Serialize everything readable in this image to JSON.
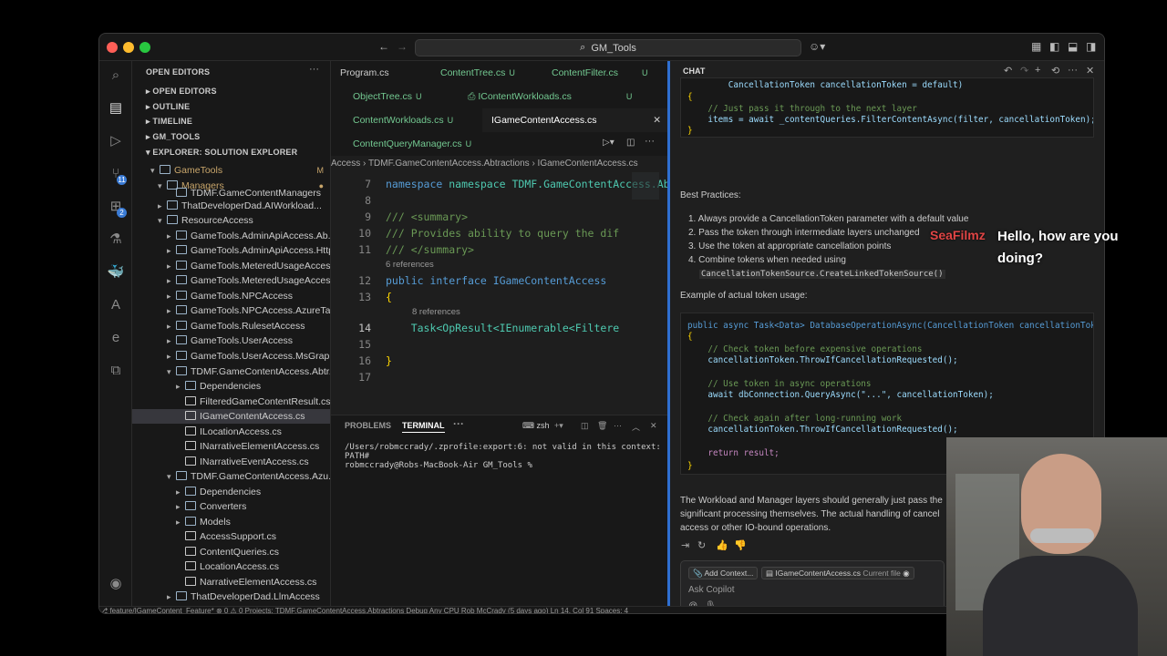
{
  "titlebar": {
    "search_label": "GM_Tools"
  },
  "activity_bar": {
    "icons": [
      "files-icon",
      "search-icon",
      "source-control-icon",
      "run-debug-icon",
      "extensions-icon",
      "testing-icon",
      "docker-icon",
      "azure-icon",
      "edge-icon",
      "remote-explorer-icon",
      "account-icon",
      "settings-gear-icon"
    ],
    "badges": {
      "source_control": "11",
      "extensions": "2"
    }
  },
  "sidebar": {
    "open_editors": "OPEN EDITORS",
    "sections": [
      "OPEN EDITORS",
      "OUTLINE",
      "TIMELINE",
      "GM_TOOLS",
      "EXPLORER: SOLUTION EXPLORER"
    ],
    "tree": [
      {
        "label": "GameTools",
        "mod": "M"
      },
      {
        "label": "Managers",
        "mod": "●"
      },
      {
        "label": "TDMF.GameContentManagers",
        "mod": ""
      },
      {
        "label": "ThatDeveloperDad.AIWorkload...",
        "mod": ""
      },
      {
        "label": "ResourceAccess",
        "mod": ""
      },
      {
        "label": "GameTools.AdminApiAccess.Ab...",
        "mod": ""
      },
      {
        "label": "GameTools.AdminApiAccess.Http",
        "mod": ""
      },
      {
        "label": "GameTools.MeteredUsageAccess",
        "mod": ""
      },
      {
        "label": "GameTools.MeteredUsageAcces...",
        "mod": ""
      },
      {
        "label": "GameTools.NPCAccess",
        "mod": ""
      },
      {
        "label": "GameTools.NPCAccess.AzureTa...",
        "mod": ""
      },
      {
        "label": "GameTools.RulesetAccess",
        "mod": ""
      },
      {
        "label": "GameTools.UserAccess",
        "mod": ""
      },
      {
        "label": "GameTools.UserAccess.MsGrap...",
        "mod": ""
      },
      {
        "label": "TDMF.GameContentAccess.Abtr...",
        "mod": ""
      },
      {
        "label": "Dependencies",
        "mod": ""
      },
      {
        "label": "FilteredGameContentResult.cs",
        "mod": ""
      },
      {
        "label": "IGameContentAccess.cs",
        "mod": ""
      },
      {
        "label": "ILocationAccess.cs",
        "mod": ""
      },
      {
        "label": "INarrativeElementAccess.cs",
        "mod": ""
      },
      {
        "label": "INarrativeEventAccess.cs",
        "mod": ""
      },
      {
        "label": "TDMF.GameContentAccess.Azu...",
        "mod": ""
      },
      {
        "label": "Dependencies",
        "mod": ""
      },
      {
        "label": "Converters",
        "mod": ""
      },
      {
        "label": "Models",
        "mod": ""
      },
      {
        "label": "AccessSupport.cs",
        "mod": ""
      },
      {
        "label": "ContentQueries.cs",
        "mod": ""
      },
      {
        "label": "LocationAccess.cs",
        "mod": ""
      },
      {
        "label": "NarrativeElementAccess.cs",
        "mod": ""
      },
      {
        "label": "ThatDeveloperDad.LlmAccess",
        "mod": ""
      }
    ]
  },
  "tabs": [
    {
      "label": "Program.cs",
      "status": ""
    },
    {
      "label": "ContentTree.cs",
      "status": "U"
    },
    {
      "label": "ContentFilter.cs",
      "status": "U"
    },
    {
      "label": "ObjectTree.cs",
      "status": "U"
    },
    {
      "label": "IContentWorkloads.cs",
      "status": "U"
    },
    {
      "label": "ContentWorkloads.cs",
      "status": "U"
    },
    {
      "label": "IGameContentAccess.cs",
      "status": ""
    },
    {
      "label": "ContentQueryManager.cs",
      "status": "U"
    }
  ],
  "breadcrumb": "Access › TDMF.GameContentAccess.Abtractions › IGameContentAccess.cs",
  "editor": {
    "lines": [
      {
        "n": "7",
        "text": "namespace TDMF.GameContentAccess.Abtr"
      },
      {
        "n": "8",
        "text": ""
      },
      {
        "n": "9",
        "text": "/// <summary>"
      },
      {
        "n": "10",
        "text": "/// Provides ability to query the dif"
      },
      {
        "n": "11",
        "text": "/// </summary>"
      },
      {
        "n": "12",
        "text": "public interface IGameContentAccess"
      },
      {
        "n": "13",
        "text": "{"
      },
      {
        "n": "14",
        "text": "    Task<OpResult<IEnumerable<Filtere"
      },
      {
        "n": "15",
        "text": ""
      },
      {
        "n": "16",
        "text": "}"
      },
      {
        "n": "17",
        "text": ""
      }
    ],
    "refs_interface": "6 references",
    "refs_method": "8 references"
  },
  "panel": {
    "tabs": [
      "PROBLEMS",
      "TERMINAL"
    ],
    "shell": "zsh",
    "terminal_lines": [
      "/Users/robmccrady/.zprofile:export:6: not valid in this context:",
      "PATH#",
      "robmccrady@Robs-MacBook-Air GM_Tools %"
    ]
  },
  "chat": {
    "title": "CHAT",
    "top_code": [
      "        CancellationToken cancellationToken = default)",
      "{",
      "    // Just pass it through to the next layer",
      "    items = await _contentQueries.FilterContentAsync(filter, cancellationToken);",
      "}"
    ],
    "best_practices_heading": "Best Practices:",
    "practices": [
      "Always provide a CancellationToken parameter with a default value",
      "Pass the token through intermediate layers unchanged",
      "Use the token at appropriate cancellation points",
      "Combine tokens when needed using"
    ],
    "inline_code": "CancellationTokenSource.CreateLinkedTokenSource()",
    "example_heading": "Example of actual token usage:",
    "example_code": [
      "public async Task<Data> DatabaseOperationAsync(CancellationToken cancellationToke",
      "{",
      "    // Check token before expensive operations",
      "    cancellationToken.ThrowIfCancellationRequested();",
      "",
      "    // Use token in async operations",
      "    await dbConnection.QueryAsync(\"...\", cancellationToken);",
      "",
      "    // Check again after long-running work",
      "    cancellationToken.ThrowIfCancellationRequested();",
      "",
      "    return result;",
      "}"
    ],
    "summary_lines": [
      "The Workload and Manager layers should generally just pass the",
      "significant processing themselves. The actual handling of cancel",
      "access or other IO-bound operations."
    ],
    "add_context": "Add Context...",
    "context_file": "IGameContentAccess.cs",
    "current_file": "Current file",
    "input_placeholder": "Ask Copilot"
  },
  "statusbar": "⎇ feature/IGameContent_Feature*   ⊗ 0 ⚠ 0   Projects: TDMF.GameContentAccess.Abtractions   Debug Any CPU      Rob McCrady (5 days ago)      Ln 14, Col 91   Spaces: 4",
  "overlay": {
    "name": "SeaFilmz",
    "message": "Hello, how are you doing?"
  },
  "colors": {
    "accent": "#2f6fd0",
    "modified": "#c9a66b",
    "untracked": "#73c991",
    "overlay_name": "#e04545"
  }
}
